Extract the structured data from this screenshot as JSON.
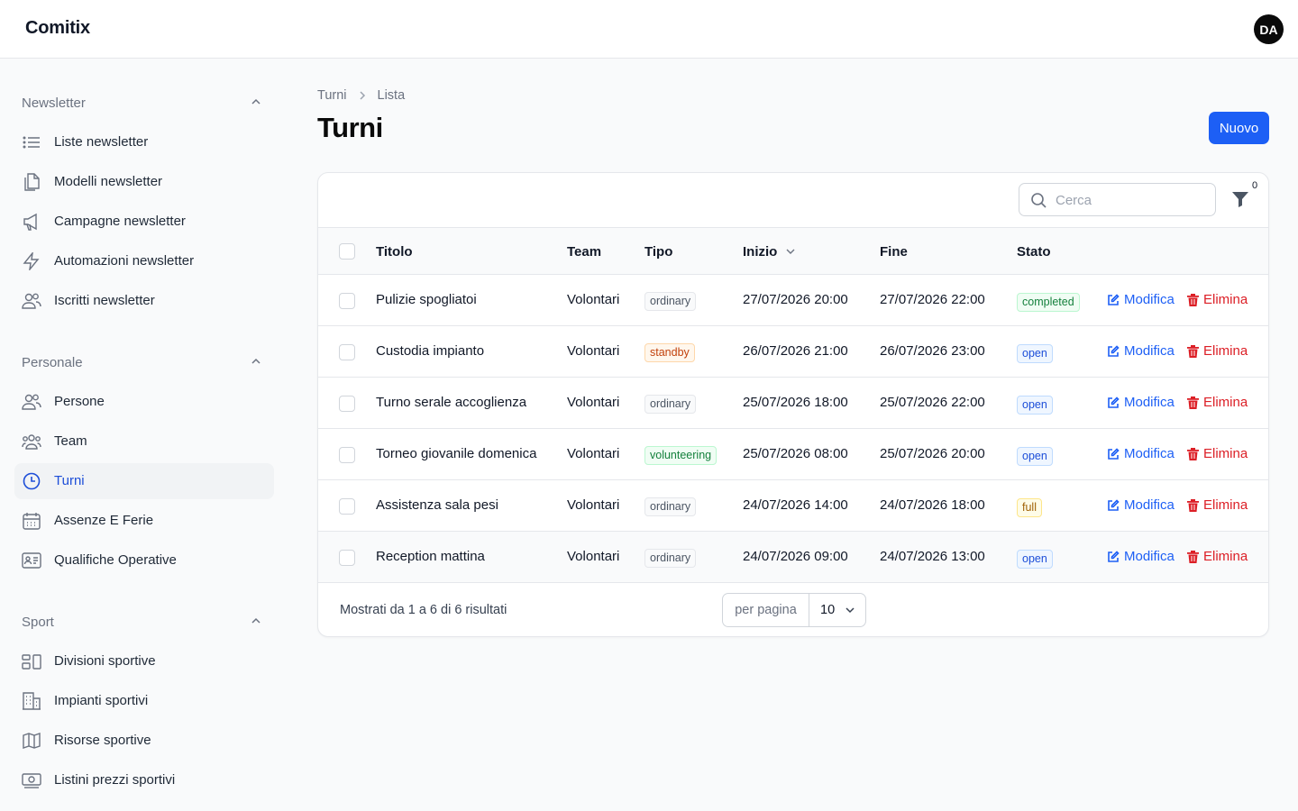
{
  "app": {
    "name": "Comitix",
    "avatar_initials": "DA"
  },
  "sidebar": {
    "groups": [
      {
        "title": "Newsletter",
        "items": [
          {
            "label": "Liste newsletter",
            "icon": "list-icon"
          },
          {
            "label": "Modelli newsletter",
            "icon": "documents-icon"
          },
          {
            "label": "Campagne newsletter",
            "icon": "megaphone-icon"
          },
          {
            "label": "Automazioni newsletter",
            "icon": "bolt-icon"
          },
          {
            "label": "Iscritti newsletter",
            "icon": "users-icon"
          }
        ]
      },
      {
        "title": "Personale",
        "items": [
          {
            "label": "Persone",
            "icon": "users-icon"
          },
          {
            "label": "Team",
            "icon": "user-group-icon"
          },
          {
            "label": "Turni",
            "icon": "clock-icon",
            "active": true
          },
          {
            "label": "Assenze E Ferie",
            "icon": "calendar-icon"
          },
          {
            "label": "Qualifiche Operative",
            "icon": "id-card-icon"
          }
        ]
      },
      {
        "title": "Sport",
        "items": [
          {
            "label": "Divisioni sportive",
            "icon": "squares-icon"
          },
          {
            "label": "Impianti sportivi",
            "icon": "building-icon"
          },
          {
            "label": "Risorse sportive",
            "icon": "map-icon"
          },
          {
            "label": "Listini prezzi sportivi",
            "icon": "banknotes-icon"
          }
        ]
      }
    ]
  },
  "breadcrumb": {
    "parent": "Turni",
    "current": "Lista"
  },
  "page": {
    "title": "Turni",
    "new_button": "Nuovo"
  },
  "toolbar": {
    "search_placeholder": "Cerca",
    "search_value": "",
    "filter_count": "0"
  },
  "table": {
    "headers": {
      "title": "Titolo",
      "team": "Team",
      "type": "Tipo",
      "start": "Inizio",
      "end": "Fine",
      "status": "Stato"
    },
    "edit_label": "Modifica",
    "delete_label": "Elimina",
    "rows": [
      {
        "title": "Pulizie spogliatoi",
        "team": "Volontari",
        "type": "ordinary",
        "start": "27/07/2026 20:00",
        "end": "27/07/2026 22:00",
        "status": "completed"
      },
      {
        "title": "Custodia impianto",
        "team": "Volontari",
        "type": "standby",
        "start": "26/07/2026 21:00",
        "end": "26/07/2026 23:00",
        "status": "open"
      },
      {
        "title": "Turno serale accoglienza",
        "team": "Volontari",
        "type": "ordinary",
        "start": "25/07/2026 18:00",
        "end": "25/07/2026 22:00",
        "status": "open"
      },
      {
        "title": "Torneo giovanile domenica",
        "team": "Volontari",
        "type": "volunteering",
        "start": "25/07/2026 08:00",
        "end": "25/07/2026 20:00",
        "status": "open"
      },
      {
        "title": "Assistenza sala pesi",
        "team": "Volontari",
        "type": "ordinary",
        "start": "24/07/2026 14:00",
        "end": "24/07/2026 18:00",
        "status": "full"
      },
      {
        "title": "Reception mattina",
        "team": "Volontari",
        "type": "ordinary",
        "start": "24/07/2026 09:00",
        "end": "24/07/2026 13:00",
        "status": "open"
      }
    ]
  },
  "footer": {
    "summary": "Mostrati da 1 a 6 di 6 risultati",
    "per_page_label": "per pagina",
    "per_page_value": "10"
  },
  "colors": {
    "accent": "#1d5ff5",
    "danger": "#dc1f26",
    "badge_ordinary": "#4b5563",
    "badge_standby": "#c2410c",
    "badge_volunteering": "#15803d",
    "badge_completed": "#15803d",
    "badge_open": "#1d4ed8",
    "badge_full": "#a16207"
  }
}
